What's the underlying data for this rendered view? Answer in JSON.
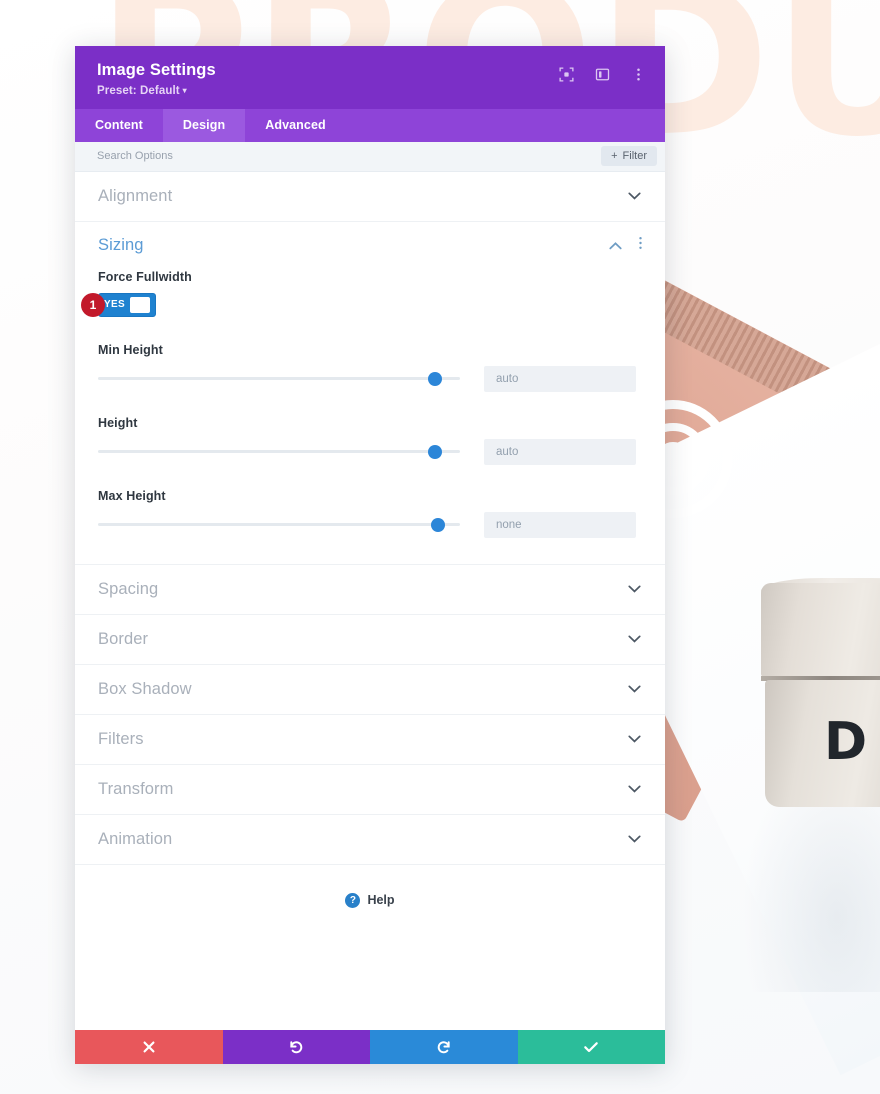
{
  "background": {
    "headline_word": "PRODU",
    "jar_letter": "D"
  },
  "modal": {
    "title": "Image Settings",
    "preset": "Preset: Default",
    "preset_caret": "▾",
    "header_icons": [
      {
        "name": "expand-icon",
        "glyph": "⬚"
      },
      {
        "name": "layout-icon",
        "glyph": "▣"
      },
      {
        "name": "more-options-icon",
        "glyph": "⋮"
      }
    ],
    "tabs": [
      {
        "label": "Content",
        "active": false
      },
      {
        "label": "Design",
        "active": true
      },
      {
        "label": "Advanced",
        "active": false
      }
    ],
    "search": {
      "placeholder": "Search Options",
      "value": ""
    },
    "filter_button": {
      "plus": "+",
      "label": "Filter"
    },
    "sections": [
      {
        "label": "Alignment",
        "expanded": false
      },
      {
        "label": "Sizing",
        "expanded": true
      },
      {
        "label": "Spacing",
        "expanded": false
      },
      {
        "label": "Border",
        "expanded": false
      },
      {
        "label": "Box Shadow",
        "expanded": false
      },
      {
        "label": "Filters",
        "expanded": false
      },
      {
        "label": "Transform",
        "expanded": false
      },
      {
        "label": "Animation",
        "expanded": false
      }
    ],
    "sizing": {
      "title": "Sizing",
      "collapse_chevron": "ⱏ",
      "menu_icon": "⋮",
      "force_fullwidth": {
        "label": "Force Fullwidth",
        "toggle_value": "YES",
        "step_badge": "1"
      },
      "sliders": [
        {
          "label": "Min Height",
          "value": "auto",
          "handle_percent": 93
        },
        {
          "label": "Height",
          "value": "auto",
          "handle_percent": 93
        },
        {
          "label": "Max Height",
          "value": "none",
          "handle_percent": 94
        }
      ]
    },
    "help": {
      "icon": "?",
      "label": "Help"
    },
    "footer_buttons": [
      {
        "name": "discard-button",
        "glyph": "✖",
        "color": "#e8575b"
      },
      {
        "name": "undo-button",
        "glyph": "↺",
        "color": "#7b2fc7"
      },
      {
        "name": "redo-button",
        "glyph": "↻",
        "color": "#2a8ad8"
      },
      {
        "name": "save-button",
        "glyph": "✔",
        "color": "#2bbd9a"
      }
    ]
  }
}
